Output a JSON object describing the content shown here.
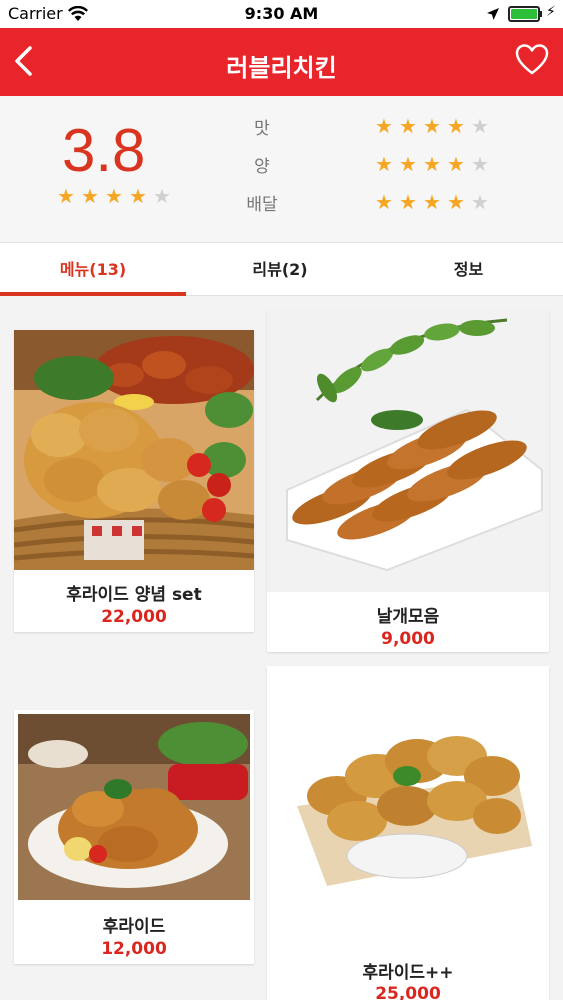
{
  "status_bar": {
    "carrier": "Carrier",
    "time": "9:30 AM"
  },
  "header": {
    "title": "러블리치킨"
  },
  "rating": {
    "score": "3.8",
    "overall_stars": 4,
    "categories": [
      {
        "label": "맛",
        "stars": 4
      },
      {
        "label": "양",
        "stars": 4
      },
      {
        "label": "배달",
        "stars": 4
      }
    ]
  },
  "tabs": [
    {
      "label": "메뉴(13)",
      "active": true
    },
    {
      "label": "리뷰(2)",
      "active": false
    },
    {
      "label": "정보",
      "active": false
    }
  ],
  "menu_items": [
    {
      "name": "후라이드 양념 set",
      "price": "22,000"
    },
    {
      "name": "날개모음",
      "price": "9,000"
    },
    {
      "name": "후라이드",
      "price": "12,000"
    },
    {
      "name": "후라이드++",
      "price": "25,000"
    }
  ],
  "colors": {
    "accent": "#e8252a",
    "price": "#d9261f",
    "star": "#f5a623"
  }
}
